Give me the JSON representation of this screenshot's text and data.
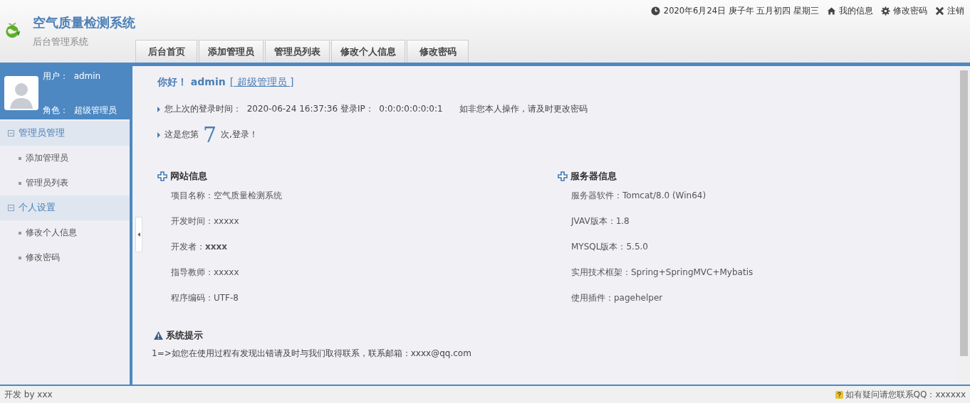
{
  "header": {
    "title": "空气质量检测系统",
    "subtitle": "后台管理系统",
    "datetime": "2020年6月24日 庚子年 五月初四 星期三",
    "links": [
      {
        "kind": "home",
        "label": "我的信息"
      },
      {
        "kind": "settings",
        "label": "修改密码"
      },
      {
        "kind": "logout",
        "label": "注销"
      }
    ]
  },
  "tabs": [
    {
      "label": "后台首页",
      "selected": false
    },
    {
      "label": "添加管理员",
      "selected": false
    },
    {
      "label": "管理员列表",
      "selected": false
    },
    {
      "label": "修改个人信息",
      "selected": false
    },
    {
      "label": "修改密码",
      "selected": false
    }
  ],
  "user": {
    "user_line": "用户：  admin",
    "role_line": "角色：  超级管理员"
  },
  "sidebar": {
    "groups": [
      {
        "label": "管理员管理",
        "expanded": true,
        "items": [
          "添加管理员",
          "管理员列表"
        ]
      },
      {
        "label": "个人设置",
        "expanded": true,
        "items": [
          "修改个人信息",
          "修改密码"
        ]
      }
    ]
  },
  "welcome": {
    "greeting": "你好！ admin",
    "role_link": "[ 超级管理员 ]",
    "last_login": "您上次的登录时间：  2020-06-24 16:37:36 登录IP：  0:0:0:0:0:0:0:1      如非您本人操作，请及时更改密码",
    "count_before": "这是您第",
    "count": "7",
    "count_after": "次,登录！"
  },
  "sections": [
    {
      "title": "网站信息",
      "rows": [
        "项目名称：空气质量检测系统",
        "开发时间：xxxxx",
        "开发者：**xxxx**",
        "指导教师：xxxxx",
        "程序编码：UTF-8"
      ]
    },
    {
      "title": "服务器信息",
      "rows": [
        "服务器软件：Tomcat/8.0 (Win64)",
        "JVAV版本：1.8",
        "MYSQL版本：5.5.0",
        "实用技术框架：Spring+SpringMVC+Mybatis",
        "使用插件：pagehelper"
      ]
    }
  ],
  "notice": {
    "title": "系统提示",
    "lines": [
      "1=>如您在使用过程有发现出错请及时与我们取得联系，联系邮箱：xxxx@qq.com"
    ]
  },
  "status_bar": {
    "left": "开发 by xxx",
    "right": "如有疑问请您联系QQ：xxxxxx"
  }
}
